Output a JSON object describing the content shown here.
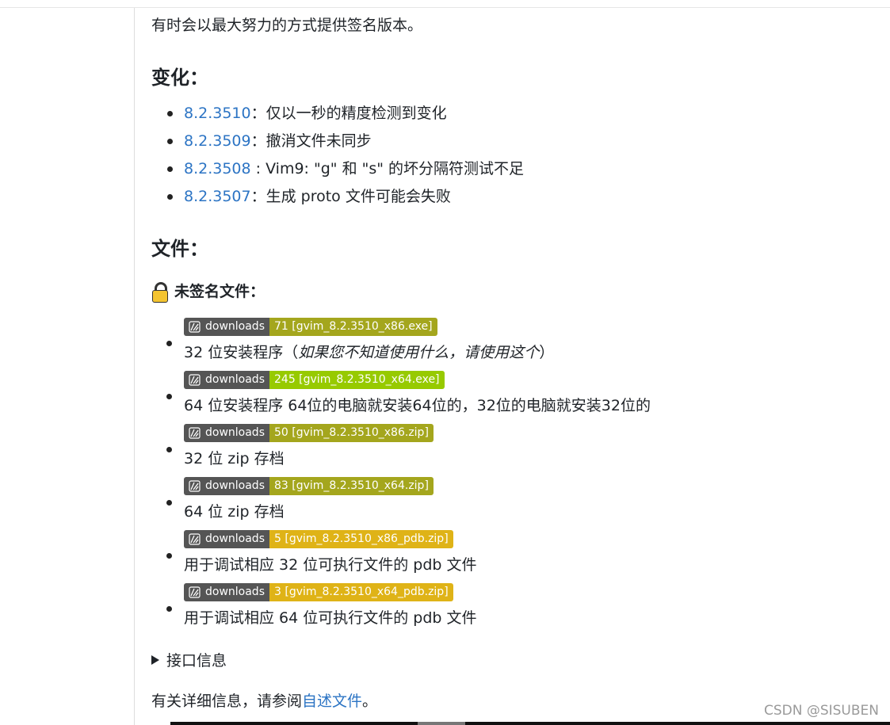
{
  "intro": "有时会以最大努力的方式提供签名版本。",
  "changes": {
    "heading": "变化：",
    "items": [
      {
        "version": "8.2.3510",
        "text": "：仅以一秒的精度检测到变化"
      },
      {
        "version": "8.2.3509",
        "text": "：撤消文件未同步"
      },
      {
        "version": "8.2.3508",
        "text": " : Vim9: \"g\" 和 \"s\" 的坏分隔符测试不足"
      },
      {
        "version": "8.2.3507",
        "text": "：生成 proto 文件可能会失败"
      }
    ]
  },
  "files": {
    "heading": "文件：",
    "unsigned_label": "未签名文件：",
    "downloads": [
      {
        "badge_label": "downloads",
        "badge_value": "71 [gvim_8.2.3510_x86.exe]",
        "color": "#a4a61d",
        "desc": "32 位安装程序（",
        "desc_em": "如果您不知道使用什么，请使用这个",
        "desc_tail": "）"
      },
      {
        "badge_label": "downloads",
        "badge_value": "245 [gvim_8.2.3510_x64.exe]",
        "color": "#97ca00",
        "desc": "64 位安装程序 64位的电脑就安装64位的，32位的电脑就安装32位的",
        "desc_em": "",
        "desc_tail": ""
      },
      {
        "badge_label": "downloads",
        "badge_value": "50 [gvim_8.2.3510_x86.zip]",
        "color": "#a4a61d",
        "desc": "32 位 zip 存档",
        "desc_em": "",
        "desc_tail": ""
      },
      {
        "badge_label": "downloads",
        "badge_value": "83 [gvim_8.2.3510_x64.zip]",
        "color": "#a4a61d",
        "desc": "64 位 zip 存档",
        "desc_em": "",
        "desc_tail": ""
      },
      {
        "badge_label": "downloads",
        "badge_value": "5 [gvim_8.2.3510_x86_pdb.zip]",
        "color": "#dfb317",
        "desc": "用于调试相应 32 位可执行文件的 pdb 文件",
        "desc_em": "",
        "desc_tail": ""
      },
      {
        "badge_label": "downloads",
        "badge_value": "3 [gvim_8.2.3510_x64_pdb.zip]",
        "color": "#dfb317",
        "desc": "用于调试相应 64 位可执行文件的 pdb 文件",
        "desc_em": "",
        "desc_tail": ""
      }
    ]
  },
  "interface_label": "接口信息",
  "readme": {
    "prefix": "有关详细信息，请参阅",
    "link": "自述文件",
    "suffix": "。"
  },
  "watermark": "CSDN @SISUBEN",
  "icons": {
    "lock": "lock-icon",
    "badge": "github-icon",
    "disclosure": "disclosure-triangle-icon"
  }
}
